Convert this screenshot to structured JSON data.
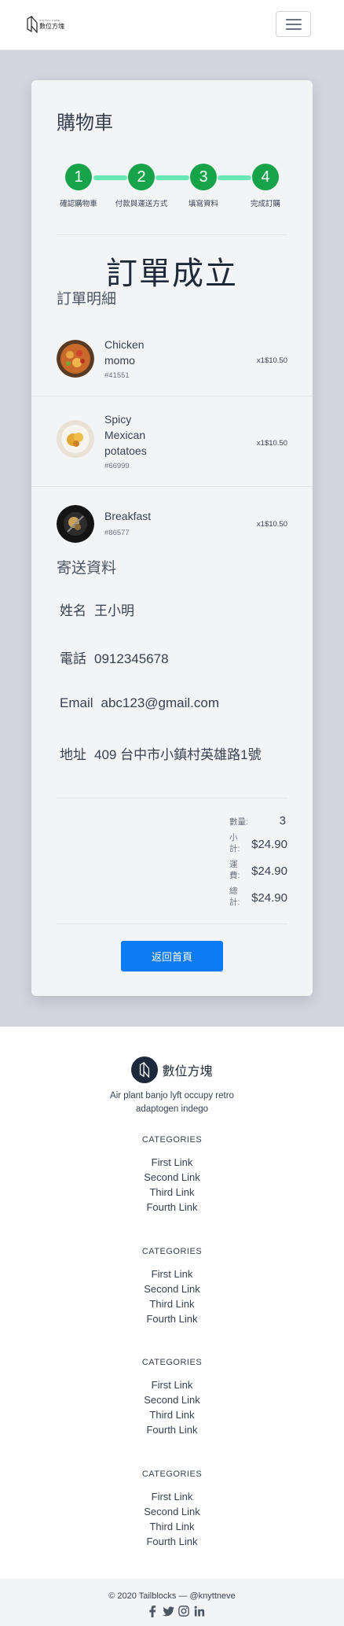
{
  "header": {
    "logo_sub": "DIGITAL CUBE",
    "logo_name": "數位方塊"
  },
  "cart": {
    "title": "購物車",
    "steps": [
      {
        "number": "1",
        "label": "確認購物車"
      },
      {
        "number": "2",
        "label": "付款與運送方式"
      },
      {
        "number": "3",
        "label": "填寫資料"
      },
      {
        "number": "4",
        "label": "完成訂購"
      }
    ],
    "success_title": "訂單成立",
    "details_title": "訂單明細",
    "items": [
      {
        "name": "Chicken momo",
        "sku": "#41551",
        "qty_price": "x1$10.50",
        "image": "food-image"
      },
      {
        "name": "Spicy Mexican potatoes",
        "sku": "#66999",
        "qty_price": "x1$10.50",
        "image": "food-image"
      },
      {
        "name": "Breakfast",
        "sku": "#86577",
        "qty_price": "x1$10.50",
        "image": "food-image"
      }
    ],
    "shipping_title": "寄送資料",
    "shipping": [
      {
        "label": "姓名",
        "value": "王小明"
      },
      {
        "label": "電話",
        "value": "0912345678"
      },
      {
        "label": "Email",
        "value": "abc123@gmail.com"
      },
      {
        "label": "地址",
        "value": "409 台中市小鎮村英雄路1號"
      }
    ],
    "summary": {
      "qty_label": "數量:",
      "qty_value": "3",
      "subtotal_label": "小計:",
      "subtotal_value": "$24.90",
      "shipping_label": "運費:",
      "shipping_value": "$24.90",
      "total_label": "總計:",
      "total_value": "$24.90"
    },
    "home_button": "返回首頁"
  },
  "footer": {
    "brand": "數位方塊",
    "description": "Air plant banjo lyft occupy retro adaptogen indego",
    "columns": [
      {
        "title": "CATEGORIES",
        "links": [
          "First Link",
          "Second Link",
          "Third Link",
          "Fourth Link"
        ]
      },
      {
        "title": "CATEGORIES",
        "links": [
          "First Link",
          "Second Link",
          "Third Link",
          "Fourth Link"
        ]
      },
      {
        "title": "CATEGORIES",
        "links": [
          "First Link",
          "Second Link",
          "Third Link",
          "Fourth Link"
        ]
      },
      {
        "title": "CATEGORIES",
        "links": [
          "First Link",
          "Second Link",
          "Third Link",
          "Fourth Link"
        ]
      }
    ],
    "copyright": "© 2020 Tailblocks — @knyttneve",
    "socials": [
      "facebook-icon",
      "twitter-icon",
      "instagram-icon",
      "linkedin-icon"
    ]
  },
  "colors": {
    "step_active": "#16a34a",
    "step_line": "#6ee7b7",
    "button": "#0d7cf2",
    "page_bg": "#d2d5dd"
  }
}
